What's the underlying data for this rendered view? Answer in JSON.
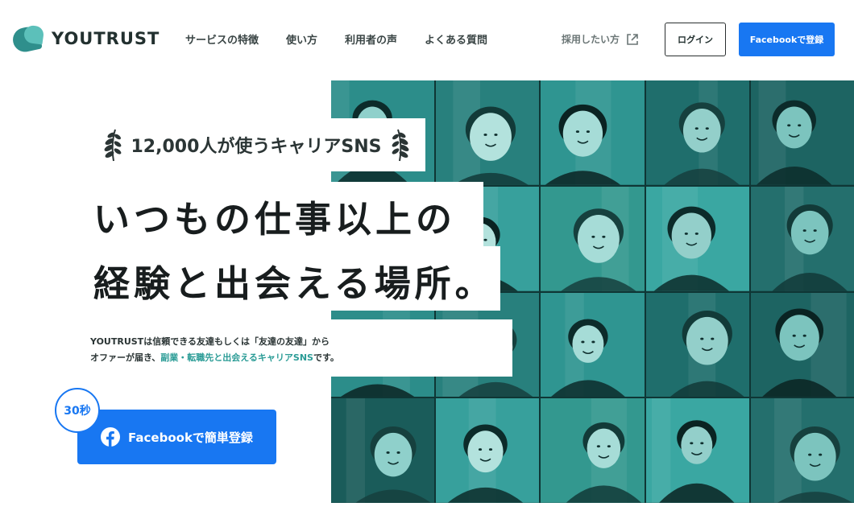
{
  "header": {
    "logo_text": "YOUTRUST",
    "nav": [
      "サービスの特徴",
      "使い方",
      "利用者の声",
      "よくある質問"
    ],
    "recruit_label": "採用したい方",
    "login_label": "ログイン",
    "facebook_signup_label": "Facebookで登録"
  },
  "hero": {
    "badge_text": "12,000人が使うキャリアSNS",
    "headline_line1": "いつもの仕事以上の",
    "headline_line2": "経験と出会える場所。",
    "description_line1": "YOUTRUSTは信頼できる友達もしくは「友達の友達」から",
    "description_line2_prefix": "オファーが届き、",
    "description_line2_highlight": "副業・転職先と出会えるキャリアSNS",
    "description_line2_suffix": "です。",
    "cta_label": "Facebookで簡単登録",
    "seconds_badge": "30秒"
  },
  "colors": {
    "brand_teal": "#2f8f8c",
    "facebook_blue": "#1877f2",
    "photo_tint": "#2a8f8c",
    "highlight_text": "#2b9c96"
  },
  "icons": {
    "laurel": "laurel-icon",
    "external": "external-link-icon",
    "facebook": "facebook-icon"
  }
}
